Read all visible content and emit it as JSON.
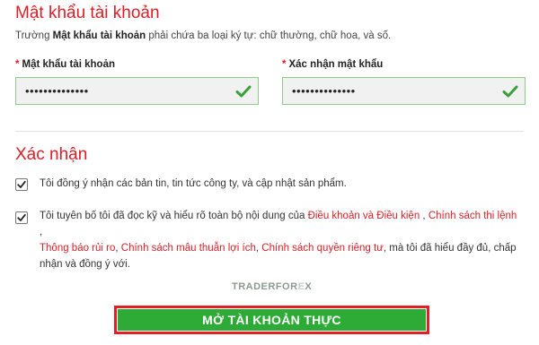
{
  "account_password": {
    "title": "Mật khẩu tài khoản",
    "hint_prefix": "Trường ",
    "hint_bold": "Mật khẩu tài khoản",
    "hint_suffix": " phải chứa ba loại ký tự: chữ thường, chữ hoa, và số.",
    "password_label": "Mật khẩu tài khoản",
    "password_value": "••••••••••••••",
    "confirm_label": "Xác nhận mật khẩu",
    "confirm_value": "••••••••••••••",
    "required_mark": "*",
    "check_icon": "check-icon",
    "valid_color": "#3aa13a"
  },
  "confirmation": {
    "title": "Xác nhận",
    "consent_news": "Tôi đồng ý nhận các bản tin, tin tức công ty, và cập nhật sản phẩm.",
    "consent_news_checked": true,
    "consent_terms_checked": true,
    "terms_intro": "Tôi tuyên bố tôi đã đọc kỹ và hiểu rõ toàn bộ nội dung của ",
    "link_terms": "Điều khoản và Điều kiện",
    "sep": " , ",
    "link_policy": "Chính sách thi lệnh",
    "sep_end": " ,",
    "link_risk": "Thông báo rủi ro",
    "comma": ", ",
    "link_conflict": "Chính sách mâu thuẫn lợi ích",
    "comma2": ", ",
    "link_privacy": "Chính sách quyền riêng tư",
    "terms_outro": ", mà tôi đã hiểu đầy đủ, chấp nhận và đồng ý với."
  },
  "watermark": {
    "brand_main": "TRADERFOR",
    "brand_x": "E",
    "brand_end": "X"
  },
  "cta": {
    "label": "MỞ TÀI KHOẢN THỰC"
  },
  "colors": {
    "accent_red": "#d81f26",
    "button_green": "#2eaa36",
    "outline_red": "#e31e24"
  }
}
